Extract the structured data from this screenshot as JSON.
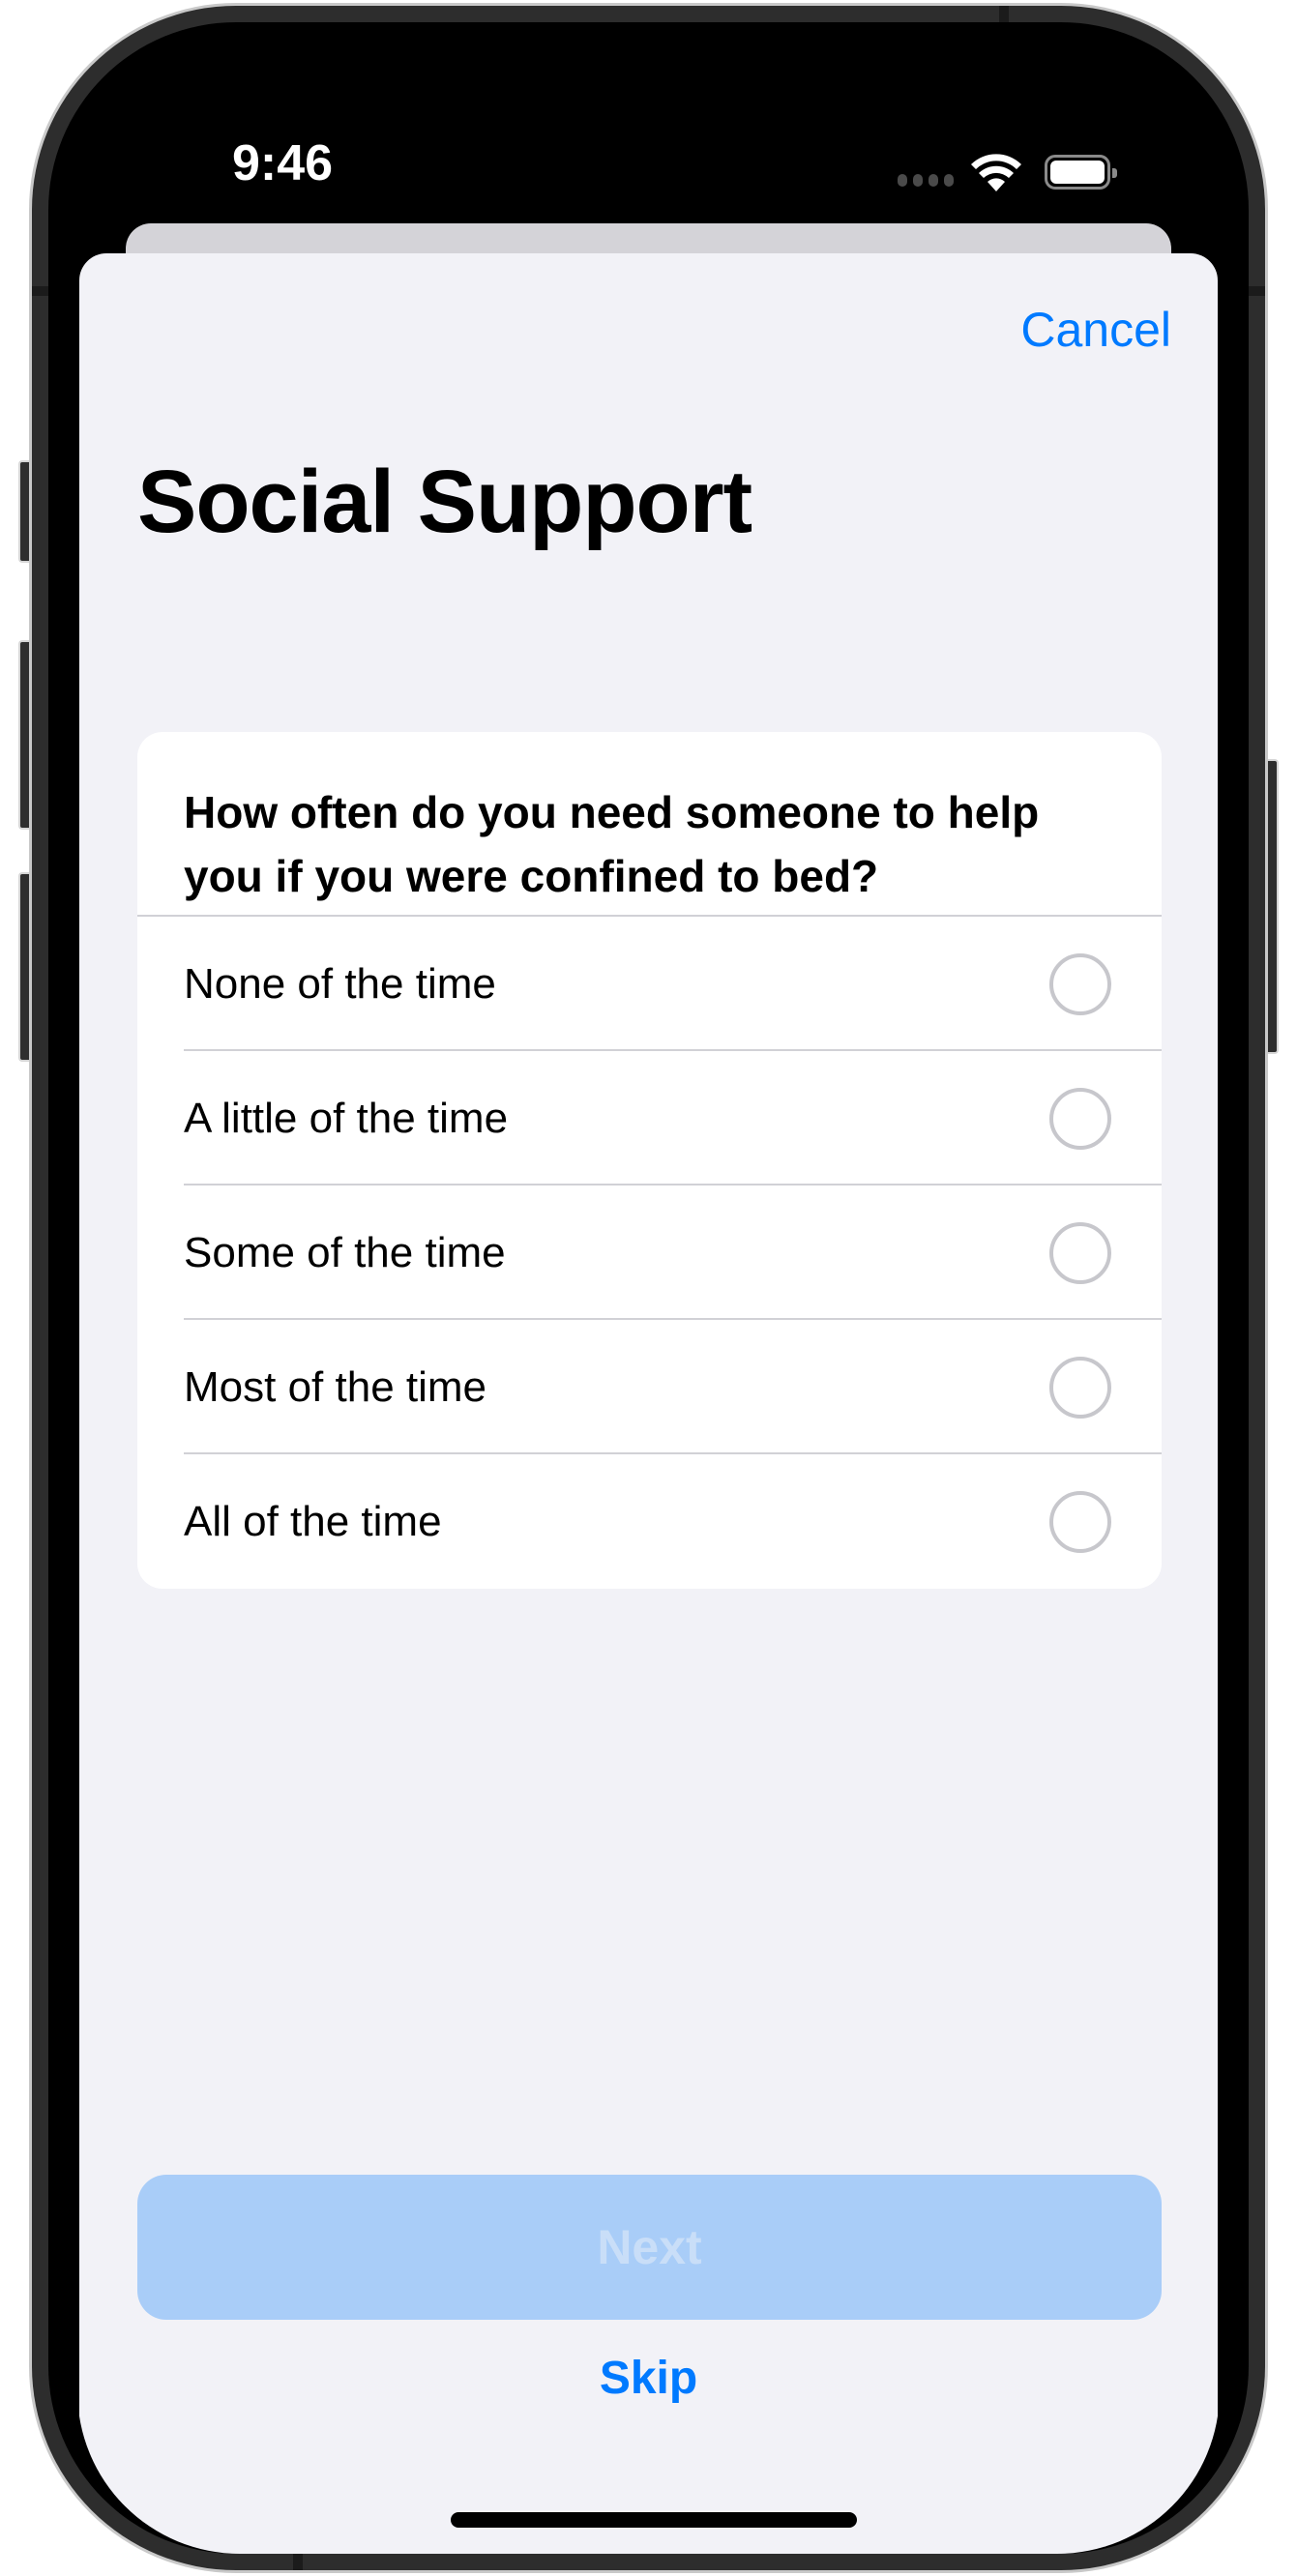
{
  "status_bar": {
    "time": "9:46",
    "icons": [
      "cellular-signal-icon",
      "wifi-icon",
      "battery-icon"
    ]
  },
  "navigation": {
    "cancel_label": "Cancel"
  },
  "page": {
    "title": "Social Support"
  },
  "question": {
    "text": "How often do you need someone to help you if you were confined to bed?",
    "options": [
      {
        "label": "None of the time",
        "selected": false
      },
      {
        "label": "A little of the time",
        "selected": false
      },
      {
        "label": "Some of the time",
        "selected": false
      },
      {
        "label": "Most of the time",
        "selected": false
      },
      {
        "label": "All of the time",
        "selected": false
      }
    ]
  },
  "actions": {
    "next_label": "Next",
    "next_enabled": false,
    "skip_label": "Skip"
  },
  "colors": {
    "accent": "#007aff",
    "background": "#f2f2f7",
    "card": "#ffffff",
    "next_disabled_bg": "#a9cdf8",
    "radio_border": "#c7c7cc"
  }
}
